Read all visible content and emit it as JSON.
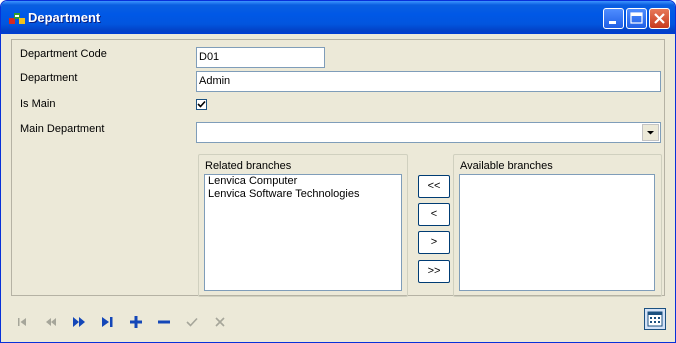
{
  "window": {
    "title": "Department"
  },
  "form": {
    "department_code_label": "Department Code",
    "department_code_value": "D01",
    "department_label": "Department",
    "department_value": "Admin",
    "is_main_label": "Is Main",
    "is_main_checked": true,
    "main_department_label": "Main Department",
    "main_department_value": ""
  },
  "related_branches": {
    "label": "Related branches",
    "items": [
      "Lenvica Computer",
      "Lenvica Software Technologies"
    ]
  },
  "available_branches": {
    "label": "Available branches",
    "items": []
  },
  "move_buttons": {
    "all_left": "<<",
    "left": "<",
    "right": ">",
    "all_right": ">>"
  },
  "navigator": {
    "icons": [
      "first-icon",
      "prior-icon",
      "next-icon",
      "last-icon",
      "insert-icon",
      "delete-icon",
      "post-icon",
      "cancel-icon"
    ],
    "enabled_color": "#1447b8",
    "disabled_color": "#a6a69a"
  }
}
